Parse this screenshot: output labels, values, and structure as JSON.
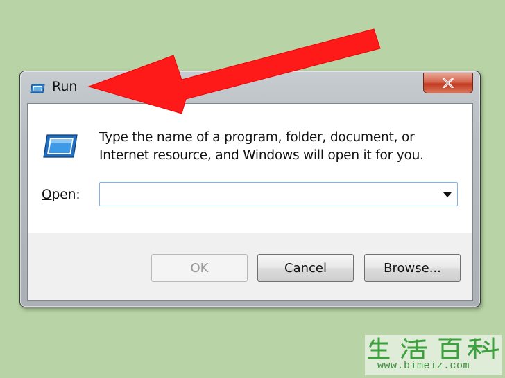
{
  "window": {
    "title": "Run",
    "description": "Type the name of a program, folder, document, or Internet resource, and Windows will open it for you.",
    "open_label_accel": "O",
    "open_label_rest": "pen:",
    "open_input_value": "",
    "buttons": {
      "ok": "OK",
      "cancel": "Cancel",
      "browse_accel": "B",
      "browse_rest": "rowse..."
    },
    "ok_disabled": true
  },
  "icons": {
    "title": "run-icon",
    "dialog": "run-icon",
    "close": "close-icon",
    "dropdown": "chevron-down-icon",
    "annotation": "red-arrow-icon"
  },
  "colors": {
    "background": "#b8d4a6",
    "close_button": "#c23b20",
    "annotation_arrow": "#ff0000",
    "combo_border": "#7eb4ea"
  },
  "watermark": {
    "logo": "生活百科",
    "url": "www.bimeiz.com"
  }
}
